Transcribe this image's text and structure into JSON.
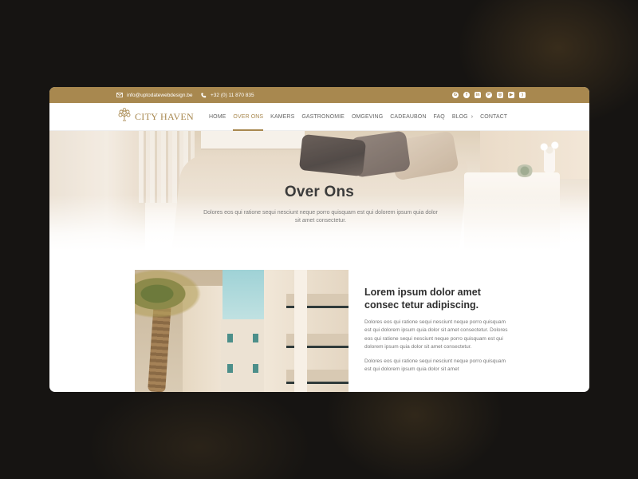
{
  "topbar": {
    "email": "info@uptodatewebdesign.be",
    "phone": "+32 (0) 11 870 835",
    "socials": [
      "google-icon",
      "facebook-icon",
      "linkedin-icon",
      "pinterest-icon",
      "instagram-icon",
      "youtube-icon",
      "rss-icon"
    ],
    "color": "#a8884f"
  },
  "nav": {
    "logo_text": "CITY HAVEN",
    "items": [
      {
        "label": "HOME"
      },
      {
        "label": "OVER ONS",
        "active": true
      },
      {
        "label": "KAMERS"
      },
      {
        "label": "GASTRONOMIE"
      },
      {
        "label": "OMGEVING"
      },
      {
        "label": "CADEAUBON"
      },
      {
        "label": "FAQ"
      },
      {
        "label": "BLOG"
      },
      {
        "label": "CONTACT"
      }
    ]
  },
  "hero": {
    "title": "Over Ons",
    "subtitle": "Dolores eos qui ratione sequi nesciunt neque porro quisquam est qui dolorem ipsum quia dolor sit amet consectetur."
  },
  "content": {
    "heading": "Lorem ipsum dolor amet consec tetur adipiscing.",
    "paragraph1": " Dolores eos qui ratione sequi nesciunt neque porro quisquam est qui dolorem ipsum quia dolor sit amet consectetur. Dolores eos qui ratione sequi nesciunt neque porro quisquam est qui dolorem ipsum quia dolor sit amet consectetur.",
    "paragraph2": "Dolores eos qui ratione sequi nesciunt neque porro quisquam est qui dolorem ipsum quia dolor sit amet"
  }
}
